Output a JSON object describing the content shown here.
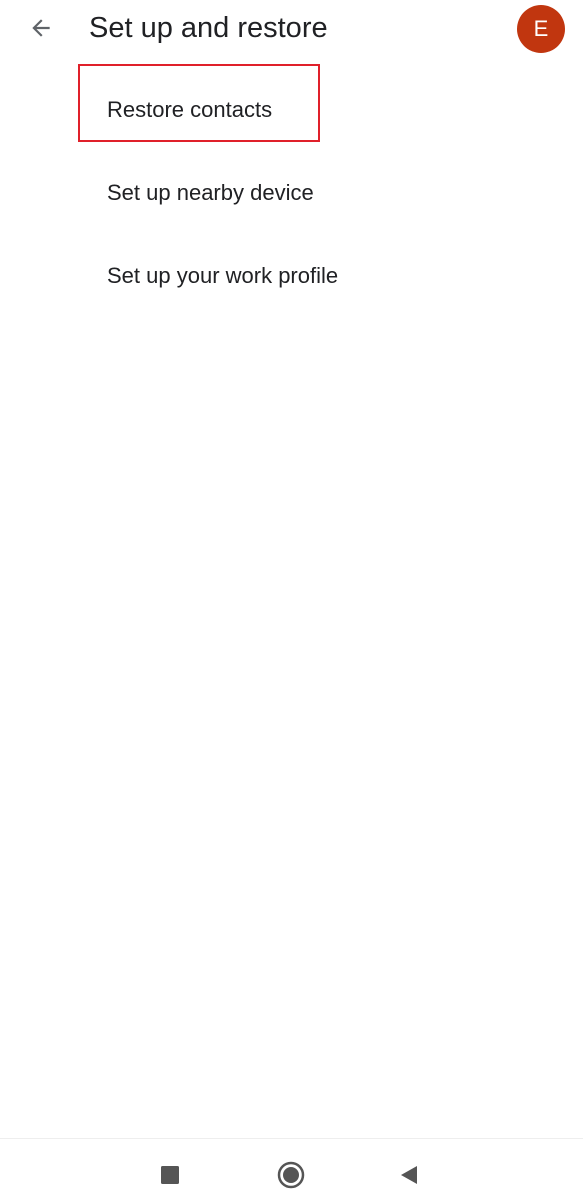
{
  "header": {
    "back_icon": "arrow-back-icon",
    "title": "Set up and restore",
    "avatar_initial": "E",
    "avatar_color": "#c1360f"
  },
  "menu": {
    "items": [
      {
        "label": "Restore contacts"
      },
      {
        "label": "Set up nearby device"
      },
      {
        "label": "Set up your work profile"
      }
    ]
  },
  "highlight": {
    "target": "Restore contacts",
    "color": "#e0202a"
  },
  "navigation_bar": {
    "recents_icon": "square-icon",
    "home_icon": "circle-icon",
    "back_icon": "triangle-back-icon"
  }
}
